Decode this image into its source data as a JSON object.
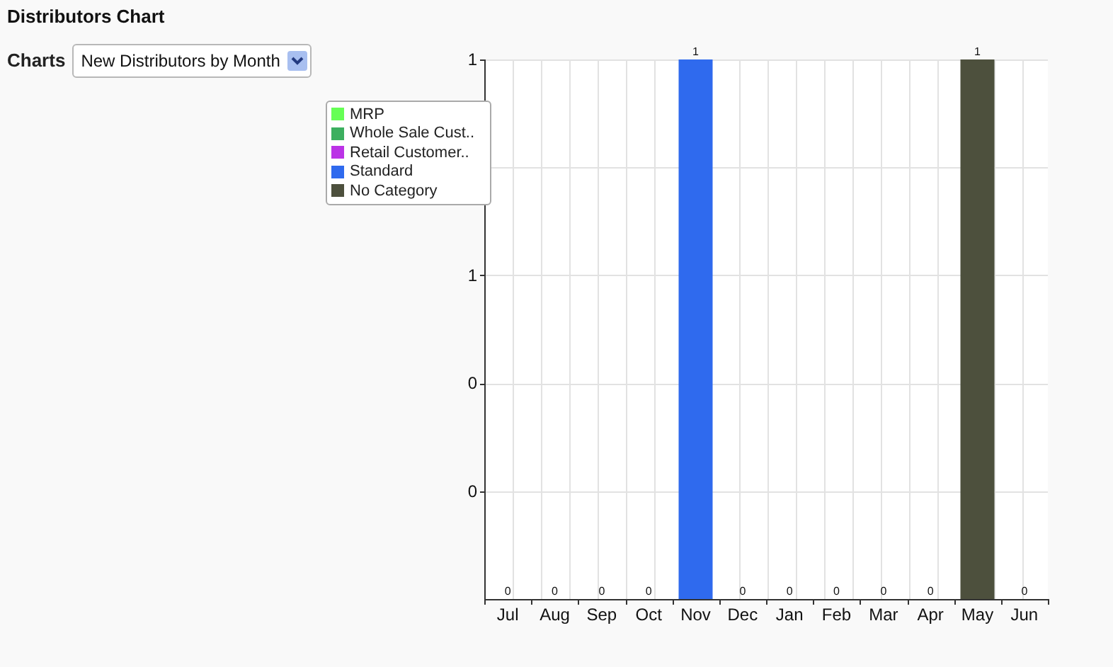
{
  "title": "Distributors Chart",
  "controls": {
    "label": "Charts",
    "select": {
      "value": "New Distributors by Month"
    }
  },
  "chart": {
    "chart_data": {
      "type": "bar",
      "stacked": true,
      "grid": true,
      "value_labels": [
        [
          null,
          null,
          null,
          null,
          null,
          null,
          null,
          null,
          null,
          null,
          null,
          null
        ],
        [
          null,
          null,
          null,
          null,
          null,
          null,
          null,
          null,
          null,
          null,
          null,
          null
        ],
        [
          null,
          null,
          null,
          null,
          null,
          null,
          null,
          null,
          null,
          null,
          null,
          null
        ],
        [
          "0",
          "0",
          "0",
          "0",
          "1",
          "0",
          "0",
          "0",
          "0",
          "0",
          null,
          "0"
        ],
        [
          null,
          null,
          null,
          null,
          null,
          null,
          null,
          null,
          null,
          null,
          "1",
          null
        ]
      ],
      "categories": [
        "Jul",
        "Aug",
        "Sep",
        "Oct",
        "Nov",
        "Dec",
        "Jan",
        "Feb",
        "Mar",
        "Apr",
        "May",
        "Jun"
      ],
      "ylim": [
        0,
        1
      ],
      "yticks": [
        {
          "value": 1,
          "label": "1"
        },
        {
          "value": 0.6,
          "label": "1"
        },
        {
          "value": 0.4,
          "label": "0"
        },
        {
          "value": 0.2,
          "label": "0"
        }
      ],
      "series": [
        {
          "name": "MRP",
          "color": "#66ff55",
          "values": [
            0,
            0,
            0,
            0,
            0,
            0,
            0,
            0,
            0,
            0,
            0,
            0
          ]
        },
        {
          "name": "Whole Sale Cust..",
          "color": "#3caf5f",
          "values": [
            0,
            0,
            0,
            0,
            0,
            0,
            0,
            0,
            0,
            0,
            0,
            0
          ]
        },
        {
          "name": "Retail Customer..",
          "color": "#bb33e6",
          "values": [
            0,
            0,
            0,
            0,
            0,
            0,
            0,
            0,
            0,
            0,
            0,
            0
          ]
        },
        {
          "name": "Standard",
          "color": "#2f6aee",
          "values": [
            0,
            0,
            0,
            0,
            1,
            0,
            0,
            0,
            0,
            0,
            0,
            0
          ]
        },
        {
          "name": "No Category",
          "color": "#4d503d",
          "values": [
            0,
            0,
            0,
            0,
            0,
            0,
            0,
            0,
            0,
            0,
            1,
            0
          ]
        }
      ]
    }
  }
}
